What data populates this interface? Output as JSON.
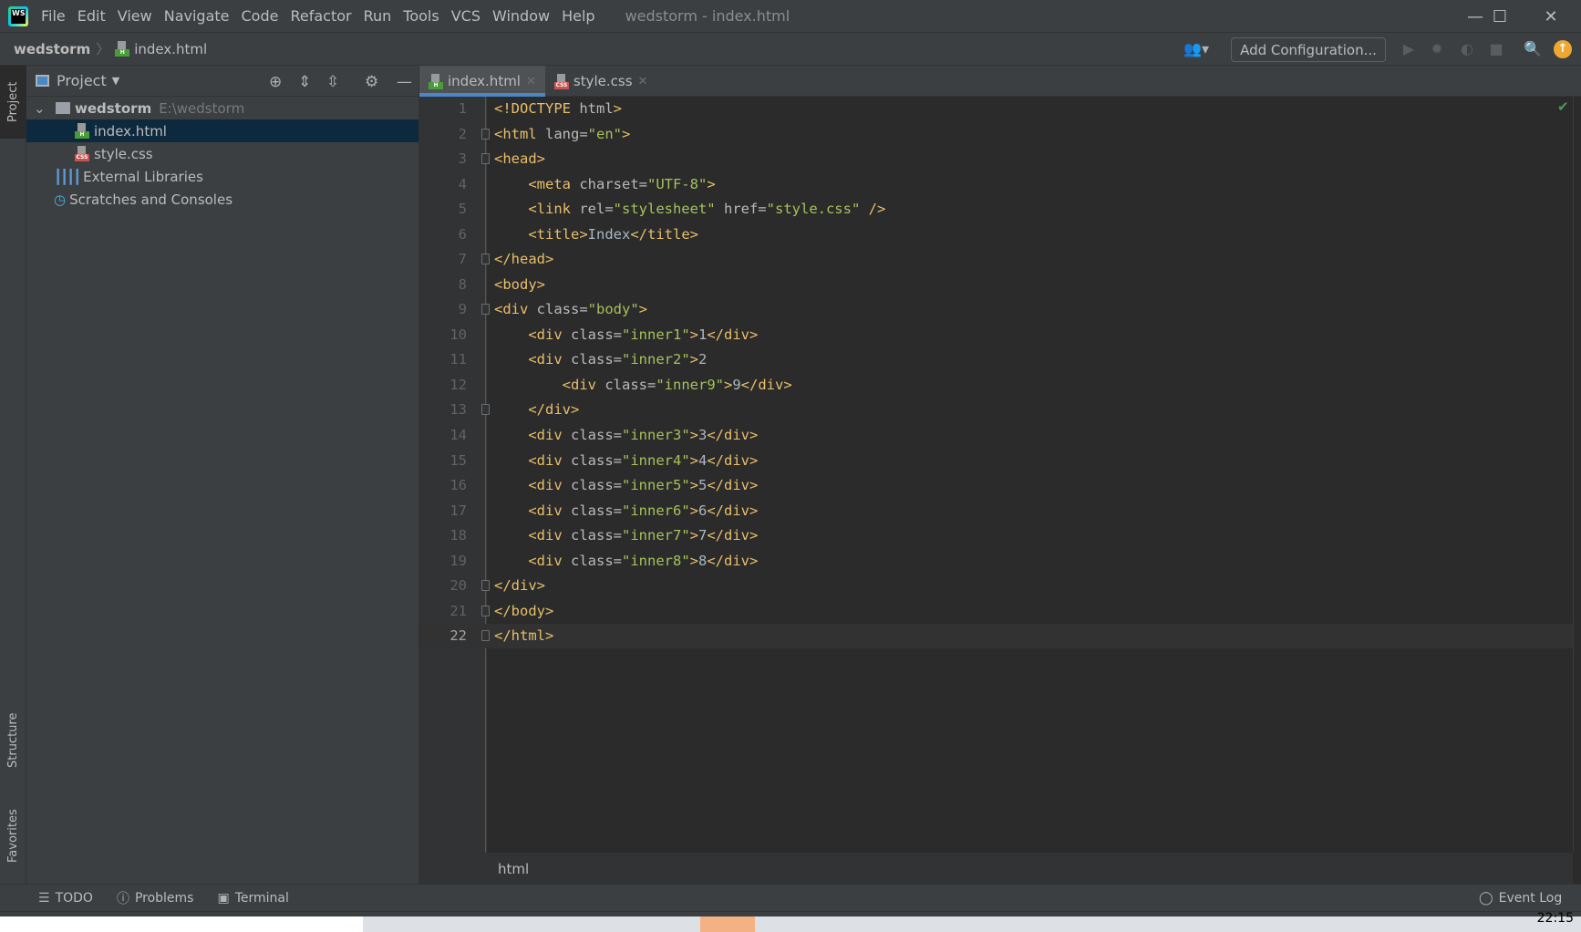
{
  "menubar": {
    "items": [
      "File",
      "Edit",
      "View",
      "Navigate",
      "Code",
      "Refactor",
      "Run",
      "Tools",
      "VCS",
      "Window",
      "Help"
    ],
    "title": "wedstorm - index.html"
  },
  "navbar": {
    "root": "wedstorm",
    "file": "index.html",
    "config_label": "Add Configuration..."
  },
  "leftstrip": {
    "project": "Project",
    "structure": "Structure",
    "favorites": "Favorites"
  },
  "project": {
    "title": "Project",
    "root": "wedstorm",
    "root_path": "E:\\wedstorm",
    "files": [
      "index.html",
      "style.css"
    ],
    "external": "External Libraries",
    "scratches": "Scratches and Consoles"
  },
  "tabs": [
    {
      "label": "index.html",
      "active": true
    },
    {
      "label": "style.css",
      "active": false
    }
  ],
  "code": [
    [
      [
        "tag",
        "<!DOCTYPE "
      ],
      [
        "attr",
        "html"
      ],
      [
        "tag",
        ">"
      ]
    ],
    [
      [
        "tag",
        "<html "
      ],
      [
        "attr",
        "lang="
      ],
      [
        "val",
        "\"en\""
      ],
      [
        "tag",
        ">"
      ]
    ],
    [
      [
        "tag",
        "<head>"
      ]
    ],
    [
      [
        "text",
        "    "
      ],
      [
        "tag",
        "<meta "
      ],
      [
        "attr",
        "charset="
      ],
      [
        "val",
        "\"UTF-8\""
      ],
      [
        "tag",
        ">"
      ]
    ],
    [
      [
        "text",
        "    "
      ],
      [
        "tag",
        "<link "
      ],
      [
        "attr",
        "rel="
      ],
      [
        "val",
        "\"stylesheet\" "
      ],
      [
        "attr",
        "href="
      ],
      [
        "val",
        "\"style.css\" "
      ],
      [
        "tag",
        "/>"
      ]
    ],
    [
      [
        "text",
        "    "
      ],
      [
        "tag",
        "<title>"
      ],
      [
        "text",
        "Index"
      ],
      [
        "tag",
        "</title>"
      ]
    ],
    [
      [
        "tag",
        "</head>"
      ]
    ],
    [
      [
        "tag",
        "<body>"
      ]
    ],
    [
      [
        "tag",
        "<div "
      ],
      [
        "attr",
        "class="
      ],
      [
        "val",
        "\"body\""
      ],
      [
        "tag",
        ">"
      ]
    ],
    [
      [
        "text",
        "    "
      ],
      [
        "tag",
        "<div "
      ],
      [
        "attr",
        "class="
      ],
      [
        "val",
        "\"inner1\""
      ],
      [
        "tag",
        ">"
      ],
      [
        "text",
        "1"
      ],
      [
        "tag",
        "</div>"
      ]
    ],
    [
      [
        "text",
        "    "
      ],
      [
        "tag",
        "<div "
      ],
      [
        "attr",
        "class="
      ],
      [
        "val",
        "\"inner2\""
      ],
      [
        "tag",
        ">"
      ],
      [
        "text",
        "2"
      ]
    ],
    [
      [
        "text",
        "        "
      ],
      [
        "tag",
        "<div "
      ],
      [
        "attr",
        "class="
      ],
      [
        "val",
        "\"inner9\""
      ],
      [
        "tag",
        ">"
      ],
      [
        "text",
        "9"
      ],
      [
        "tag",
        "</div>"
      ]
    ],
    [
      [
        "text",
        "    "
      ],
      [
        "tag",
        "</div>"
      ]
    ],
    [
      [
        "text",
        "    "
      ],
      [
        "tag",
        "<div "
      ],
      [
        "attr",
        "class="
      ],
      [
        "val",
        "\"inner3\""
      ],
      [
        "tag",
        ">"
      ],
      [
        "text",
        "3"
      ],
      [
        "tag",
        "</div>"
      ]
    ],
    [
      [
        "text",
        "    "
      ],
      [
        "tag",
        "<div "
      ],
      [
        "attr",
        "class="
      ],
      [
        "val",
        "\"inner4\""
      ],
      [
        "tag",
        ">"
      ],
      [
        "text",
        "4"
      ],
      [
        "tag",
        "</div>"
      ]
    ],
    [
      [
        "text",
        "    "
      ],
      [
        "tag",
        "<div "
      ],
      [
        "attr",
        "class="
      ],
      [
        "val",
        "\"inner5\""
      ],
      [
        "tag",
        ">"
      ],
      [
        "text",
        "5"
      ],
      [
        "tag",
        "</div>"
      ]
    ],
    [
      [
        "text",
        "    "
      ],
      [
        "tag",
        "<div "
      ],
      [
        "attr",
        "class="
      ],
      [
        "val",
        "\"inner6\""
      ],
      [
        "tag",
        ">"
      ],
      [
        "text",
        "6"
      ],
      [
        "tag",
        "</div>"
      ]
    ],
    [
      [
        "text",
        "    "
      ],
      [
        "tag",
        "<div "
      ],
      [
        "attr",
        "class="
      ],
      [
        "val",
        "\"inner7\""
      ],
      [
        "tag",
        ">"
      ],
      [
        "text",
        "7"
      ],
      [
        "tag",
        "</div>"
      ]
    ],
    [
      [
        "text",
        "    "
      ],
      [
        "tag",
        "<div "
      ],
      [
        "attr",
        "class="
      ],
      [
        "val",
        "\"inner8\""
      ],
      [
        "tag",
        ">"
      ],
      [
        "text",
        "8"
      ],
      [
        "tag",
        "</div>"
      ]
    ],
    [
      [
        "tag",
        "</div>"
      ]
    ],
    [
      [
        "tag",
        "</body>"
      ]
    ],
    [
      [
        "tag",
        "</html>"
      ]
    ]
  ],
  "folds": [
    2,
    3,
    7,
    9,
    13,
    20,
    21,
    22
  ],
  "current_line": 22,
  "editor_breadcrumb": "html",
  "bottom": {
    "todo": "TODO",
    "problems": "Problems",
    "terminal": "Terminal",
    "event_log": "Event Log"
  },
  "taskbar": {
    "clock": "22:15"
  },
  "colors": {
    "tag": "#e8bf6a",
    "attr": "#bababa",
    "val": "#a5c25c",
    "text": "#a9b7c6",
    "accent": "#4a88c7",
    "update": "#f0a732"
  }
}
